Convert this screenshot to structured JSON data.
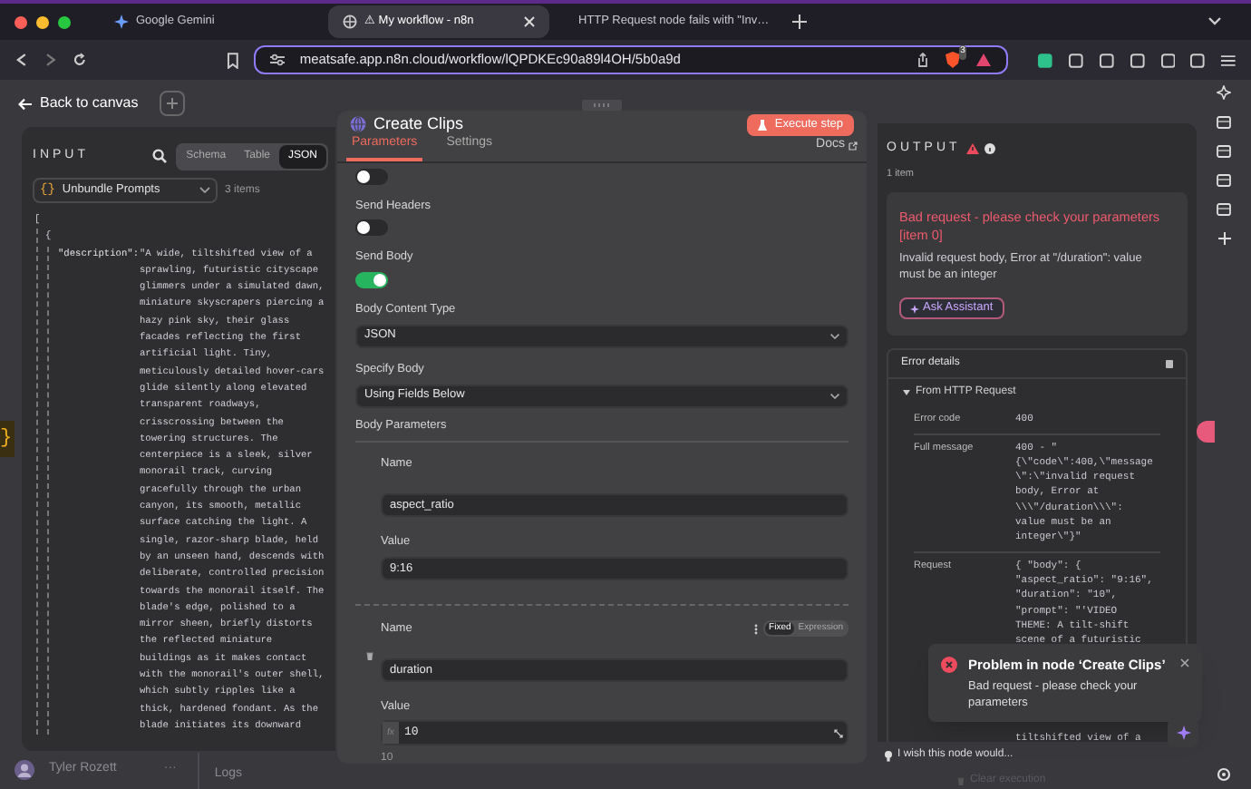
{
  "browser": {
    "tabs": [
      {
        "label": "Google Gemini",
        "selected": false
      },
      {
        "label": "⚠ My workflow - n8n",
        "selected": true
      },
      {
        "label": "HTTP Request node fails with \"Inv…",
        "selected": false
      }
    ],
    "url": "meatsafe.app.n8n.cloud/workflow/lQPDKEc90a89l4OH/5b0a9d",
    "shield_count": "3"
  },
  "back_link": "Back to canvas",
  "input": {
    "title": "INPUT",
    "views": [
      {
        "label": "Schema",
        "selected": false
      },
      {
        "label": "Table",
        "selected": false
      },
      {
        "label": "JSON",
        "selected": true
      }
    ],
    "source_icon": "{}",
    "edge_mark": "}",
    "source": "Unbundle Prompts",
    "count": "3 items",
    "open_bracket": "[",
    "open_brace": "{",
    "key": "\"description\":",
    "value_lines": [
      "\"A wide, tiltshifted view of a",
      "sprawling, futuristic cityscape",
      "glimmers under a simulated dawn,",
      "miniature skyscrapers piercing a",
      "hazy pink sky, their glass",
      "facades reflecting the first",
      "artificial light. Tiny,",
      "meticulously detailed hover-cars",
      "glide silently along elevated",
      "transparent roadways,",
      "crisscrossing between the",
      "towering structures. The",
      "centerpiece is a sleek, silver",
      "monorail track, curving",
      "gracefully through the urban",
      "canyon, its smooth, metallic",
      "surface catching the light. A",
      "single, razor-sharp blade, held",
      "by an unseen hand, descends with",
      "deliberate, controlled precision",
      "towards the monorail itself. The",
      "blade's edge, polished to a",
      "mirror sheen, briefly distorts",
      "the reflected miniature",
      "buildings as it makes contact",
      "with the monorail's outer shell,",
      "which subtly ripples like a",
      "thick, hardened fondant. As the",
      "blade initiates its downward"
    ]
  },
  "node": {
    "title": "Create Clips",
    "execute": "Execute step",
    "tabs": [
      {
        "label": "Parameters",
        "selected": true
      },
      {
        "label": "Settings",
        "selected": false
      }
    ],
    "docs": "Docs",
    "params": [
      {
        "kind": "toggle",
        "on": false
      },
      {
        "kind": "toggle",
        "label": "Send Headers",
        "on": false
      },
      {
        "kind": "toggle",
        "label": "Send Body",
        "on": true
      },
      {
        "kind": "select",
        "label": "Body Content Type",
        "value": "JSON"
      },
      {
        "kind": "select",
        "label": "Specify Body",
        "value": "Using Fields Below"
      }
    ],
    "body_params_label": "Body Parameters",
    "body_params": [
      {
        "name_label": "Name",
        "name": "aspect_ratio",
        "value_label": "Value",
        "value": "9:16"
      },
      {
        "name_label": "Name",
        "name": "duration",
        "value_label": "Value",
        "value": "10",
        "hint": "10",
        "value_marker": "fx",
        "modes": [
          {
            "label": "Fixed",
            "selected": true
          },
          {
            "label": "Expression",
            "selected": false
          }
        ]
      }
    ]
  },
  "output": {
    "title": "OUTPUT",
    "count": "1 item",
    "error_title": "Bad request - please check your parameters [item 0]",
    "error_message": "Invalid request body, Error at \"/duration\": value must be an integer",
    "ask": "Ask Assistant",
    "details_title": "Error details",
    "source": "From HTTP Request",
    "rows": [
      {
        "label": "Error code",
        "lines": [
          "400"
        ]
      },
      {
        "label": "Full message",
        "lines": [
          "400 - \"",
          "{\\\"code\\\":400,\\\"message",
          "\\\":\\\"invalid request",
          "body, Error at",
          "\\\\\\\"/duration\\\\\\\":",
          "value must be an",
          "integer\\\"}\""
        ]
      },
      {
        "label": "Request",
        "lines": [
          "{ \"body\": {",
          "\"aspect_ratio\": \"9:16\",",
          "\"duration\": \"10\",",
          "\"prompt\": \"'VIDEO",
          "THEME: A tilt-shift",
          "scene of a futuristic"
        ],
        "lines_below_toast": [
          "tiltshifted view of a"
        ]
      }
    ],
    "wish": "I wish this node would...",
    "clear": "Clear execution"
  },
  "toast": {
    "title": "Problem in node ‘Create Clips’",
    "message": "Bad request - please check your parameters"
  },
  "footer": {
    "user": "Tyler Rozett",
    "more": "···",
    "logs": "Logs"
  }
}
